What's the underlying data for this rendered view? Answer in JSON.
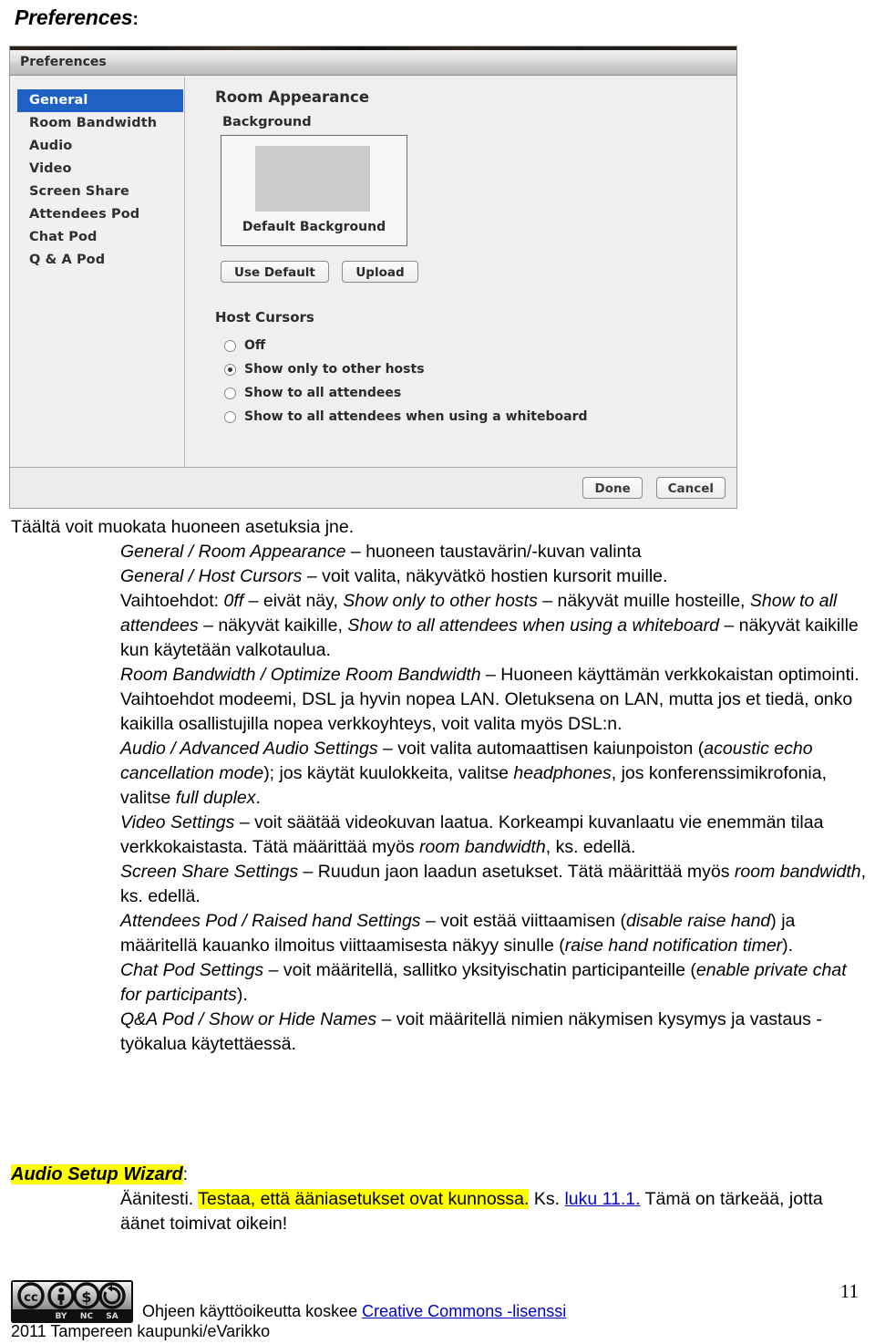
{
  "doc": {
    "heading": "Preferences",
    "heading_colon": ":",
    "page_number": "11"
  },
  "dialog": {
    "title": "Preferences",
    "sidebar": {
      "items": [
        {
          "label": "General",
          "selected": true
        },
        {
          "label": "Room Bandwidth",
          "selected": false
        },
        {
          "label": "Audio",
          "selected": false
        },
        {
          "label": "Video",
          "selected": false
        },
        {
          "label": "Screen Share",
          "selected": false
        },
        {
          "label": "Attendees Pod",
          "selected": false
        },
        {
          "label": "Chat Pod",
          "selected": false
        },
        {
          "label": "Q & A Pod",
          "selected": false
        }
      ]
    },
    "content": {
      "section_title": "Room Appearance",
      "background_group_label": "Background",
      "background_thumb_caption": "Default Background",
      "use_default_button": "Use Default",
      "upload_button": "Upload",
      "host_cursors_label": "Host Cursors",
      "host_cursor_options": [
        {
          "label": "Off",
          "checked": false
        },
        {
          "label": "Show only to other hosts",
          "checked": true
        },
        {
          "label": "Show to all attendees",
          "checked": false
        },
        {
          "label": "Show to all attendees when using a whiteboard",
          "checked": false
        }
      ]
    },
    "footer": {
      "done_button": "Done",
      "cancel_button": "Cancel"
    },
    "accent_color": "#1f62c4"
  },
  "prose": {
    "intro": "Täältä voit muokata huoneen asetuksia jne.",
    "items": [
      {
        "term": "General / Room Appearance",
        "dash": " – ",
        "text": "huoneen taustavärin/-kuvan valinta"
      },
      {
        "term": "General / Host Cursors",
        "dash": " – ",
        "text": "voit valita, näkyvätkö hostien kursorit muille."
      }
    ],
    "options_line_lead": "Vaihtoehdot: ",
    "options_off": "0ff",
    "options_off_tail": " – eivät näy, ",
    "options_hosts": "Show only to other hosts",
    "options_hosts_tail": " – näkyvät muille hosteille, ",
    "options_all": "Show to all attendees",
    "options_all_tail": " – näkyvät kaikille, ",
    "options_wb": "Show to all attendees when using a whiteboard",
    "options_wb_tail": " – näkyvät kaikille kun käytetään valkotaulua.",
    "bandwidth_term": "Room Bandwidth / Optimize Room Bandwidth",
    "bandwidth_text": " – Huoneen käyttämän verkkokaistan optimointi. Vaihtoehdot modeemi, DSL ja hyvin nopea LAN. Oletuksena on LAN, mutta jos et tiedä, onko kaikilla osallistujilla nopea verkkoyhteys, voit valita myös DSL:n.",
    "audio_term": "Audio / Advanced Audio Settings",
    "audio_text_1": " – voit valita automaattisen kaiunpoiston (",
    "audio_em_1": "acoustic echo cancellation mode",
    "audio_text_2": "); jos käytät kuulokkeita, valitse ",
    "audio_em_2": "headphones",
    "audio_text_3": ", jos konferenssimikrofonia, valitse ",
    "audio_em_3": "full duplex",
    "audio_text_4": ".",
    "video_term": "Video Settings",
    "video_text_1": " – voit säätää videokuvan laatua. Korkeampi kuvanlaatu vie enemmän tilaa verkkokaistasta. Tätä määrittää myös ",
    "video_em_1": "room bandwidth",
    "video_text_2": ", ks. edellä.",
    "screen_term": "Screen Share Settings",
    "screen_text_1": " – Ruudun jaon laadun asetukset. Tätä määrittää myös ",
    "screen_em_1": "room bandwidth",
    "screen_text_2": ", ks. edellä.",
    "attendees_term": "Attendees Pod / Raised hand Settings",
    "attendees_text_1": " – voit estää viittaamisen (",
    "attendees_em_1": "disable raise hand",
    "attendees_text_2": ") ja määritellä kauanko ilmoitus viittaamisesta näkyy sinulle (",
    "attendees_em_2": "raise hand notification timer",
    "attendees_text_3": ").",
    "chat_term": "Chat Pod Settings",
    "chat_text_1": " – voit määritellä, sallitko yksityischatin participanteille (",
    "chat_em_1": "enable private chat for participants",
    "chat_text_2": ").",
    "qa_term": "Q&A Pod / Show or Hide Names",
    "qa_text": " – voit määritellä nimien näkymisen kysymys ja vastaus -työkalua käytettäessä."
  },
  "audio_setup_wizard": {
    "heading": "Audio Setup Wizard",
    "heading_colon": ":",
    "line_lead": "Äänitesti. ",
    "highlight": "Testaa, että ääniasetukset ovat kunnossa.",
    "after_highlight": " Ks. ",
    "link": "luku 11.1.",
    "tail": " Tämä on tärkeää, jotta äänet toimivat oikein!"
  },
  "page_footer": {
    "license_text": "Ohjeen käyttöoikeutta koskee ",
    "license_link": "Creative Commons -lisenssi",
    "copyright": "2011 Tampereen kaupunki/eVarikko",
    "cc_marks": [
      "BY",
      "NC",
      "SA"
    ]
  }
}
